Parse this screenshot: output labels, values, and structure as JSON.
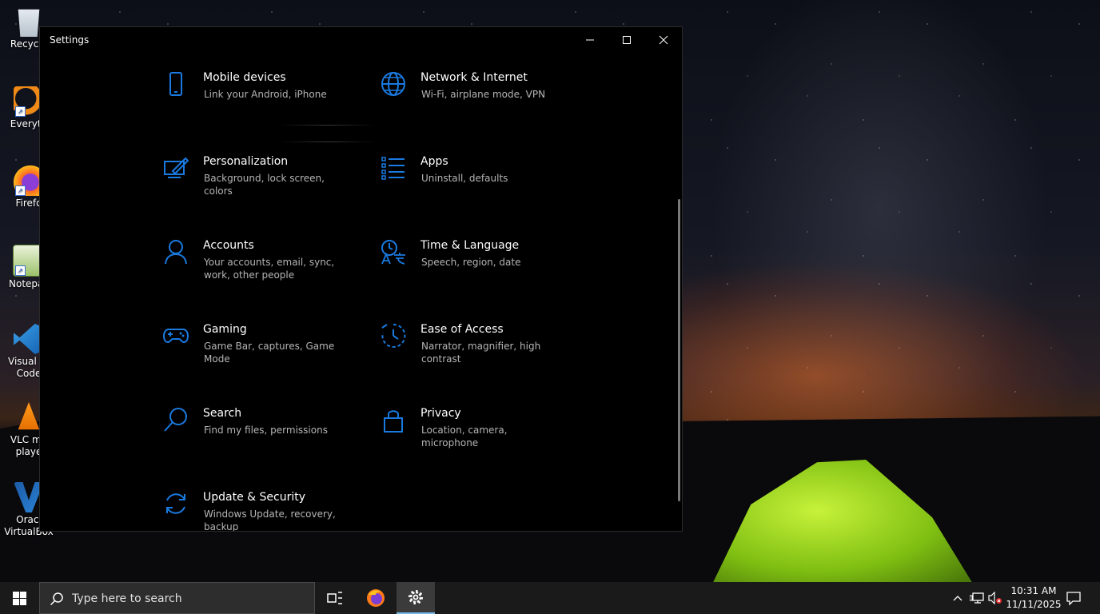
{
  "desktop": {
    "icons": [
      {
        "label": "Recycle"
      },
      {
        "label": "Everyth"
      },
      {
        "label": "Firefo"
      },
      {
        "label": "Notepac"
      },
      {
        "label": "Visual St Code"
      },
      {
        "label": "VLC me playe"
      },
      {
        "label": "Oracl VirtualBox"
      }
    ]
  },
  "window": {
    "title": "Settings",
    "tiles": [
      {
        "title": "Mobile devices",
        "desc": "Link your Android, iPhone",
        "icon": "phone-icon"
      },
      {
        "title": "Network & Internet",
        "desc": "Wi-Fi, airplane mode, VPN",
        "icon": "globe-icon"
      },
      {
        "title": "Personalization",
        "desc": "Background, lock screen, colors",
        "icon": "paint-icon"
      },
      {
        "title": "Apps",
        "desc": "Uninstall, defaults",
        "icon": "apps-list-icon"
      },
      {
        "title": "Accounts",
        "desc": "Your accounts, email, sync, work, other people",
        "icon": "person-icon"
      },
      {
        "title": "Time & Language",
        "desc": "Speech, region, date",
        "icon": "time-language-icon"
      },
      {
        "title": "Gaming",
        "desc": "Game Bar, captures, Game Mode",
        "icon": "gamepad-icon"
      },
      {
        "title": "Ease of Access",
        "desc": "Narrator, magnifier, high contrast",
        "icon": "ease-of-access-icon"
      },
      {
        "title": "Search",
        "desc": "Find my files, permissions",
        "icon": "search-icon"
      },
      {
        "title": "Privacy",
        "desc": "Location, camera, microphone",
        "icon": "lock-icon"
      },
      {
        "title": "Update & Security",
        "desc": "Windows Update, recovery, backup",
        "icon": "sync-icon"
      }
    ]
  },
  "taskbar": {
    "search_placeholder": "Type here to search",
    "time": "10:31 AM",
    "date": "11/11/2025"
  },
  "colors": {
    "accent": "#1a7ae0",
    "window_bg": "#000000",
    "taskbar_bg": "#1a1a1a"
  }
}
